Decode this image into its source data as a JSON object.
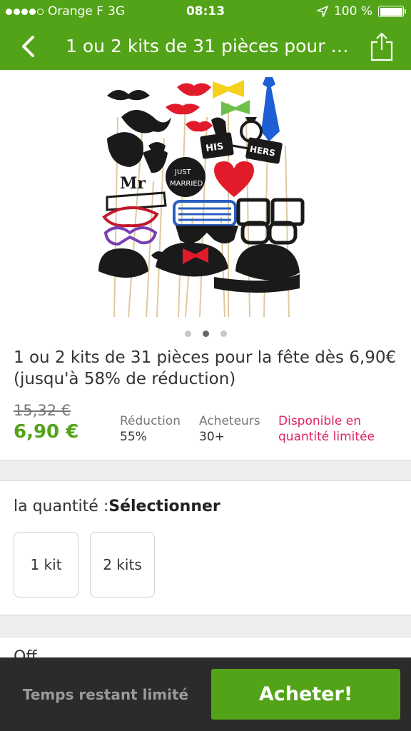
{
  "status_bar": {
    "carrier": "Orange F",
    "network": "3G",
    "time": "08:13",
    "battery": "100 %",
    "battery_level": 1.0,
    "signal_bars_filled": 4,
    "signal_bars_total": 5
  },
  "nav": {
    "title": "1 ou 2 kits de 31 pièces pour la fête dès 6,90€ (jusqu'à 58% de réduction)",
    "back_icon": "chevron-left-icon",
    "share_icon": "share-icon"
  },
  "gallery": {
    "image_count": 3,
    "active_index": 1
  },
  "product": {
    "title": "1 ou 2 kits de 31 pièces pour la fête dès 6,90€ (jusqu'à 58% de réduction)",
    "old_price": "15,32 €",
    "price": "6,90 €",
    "stats": [
      {
        "label": "Réduction",
        "value": "55%"
      },
      {
        "label": "Acheteurs",
        "value": "30+"
      }
    ],
    "availability": "Disponible en quantité limitée"
  },
  "quantity": {
    "label": "la quantité :",
    "selected": "Sélectionner",
    "options": [
      "1 kit",
      "2 kits"
    ]
  },
  "next_section_peek": "Off",
  "footer": {
    "note": "Temps restant limité",
    "buy_label": "Acheter!"
  },
  "colors": {
    "accent": "#53a318",
    "availability": "#e0245e",
    "footer_bg": "#2b2b2b"
  }
}
